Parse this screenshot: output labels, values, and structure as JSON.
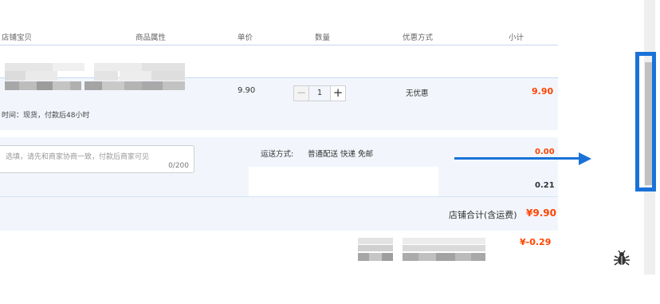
{
  "table_header": {
    "shop_item": "店铺宝贝",
    "properties": "商品属性",
    "unit_price": "单价",
    "quantity": "数量",
    "discount": "优惠方式",
    "subtotal": "小计"
  },
  "item": {
    "unit_price": "9.90",
    "quantity_value": "1",
    "quantity_minus": "−",
    "quantity_plus": "+",
    "discount": "无优惠",
    "subtotal": "9.90",
    "delivery_note": "时间：现货，付款后48小时"
  },
  "memo": {
    "placeholder": "选填，请先和商家协商一致，付款后商家可见",
    "counter": "0/200"
  },
  "shipping": {
    "label": "运送方式:",
    "method": "普通配送 快递 免邮",
    "cost": "0.00"
  },
  "misc_value": "0.21",
  "shop_total": {
    "label": "店铺合计(含运费)",
    "value": "¥9.90"
  },
  "discount_total": "¥-0.29",
  "icons": {
    "debug": "bug-icon"
  },
  "colors": {
    "price_red": "#ff4400",
    "annotation_blue": "#1a72d8"
  }
}
